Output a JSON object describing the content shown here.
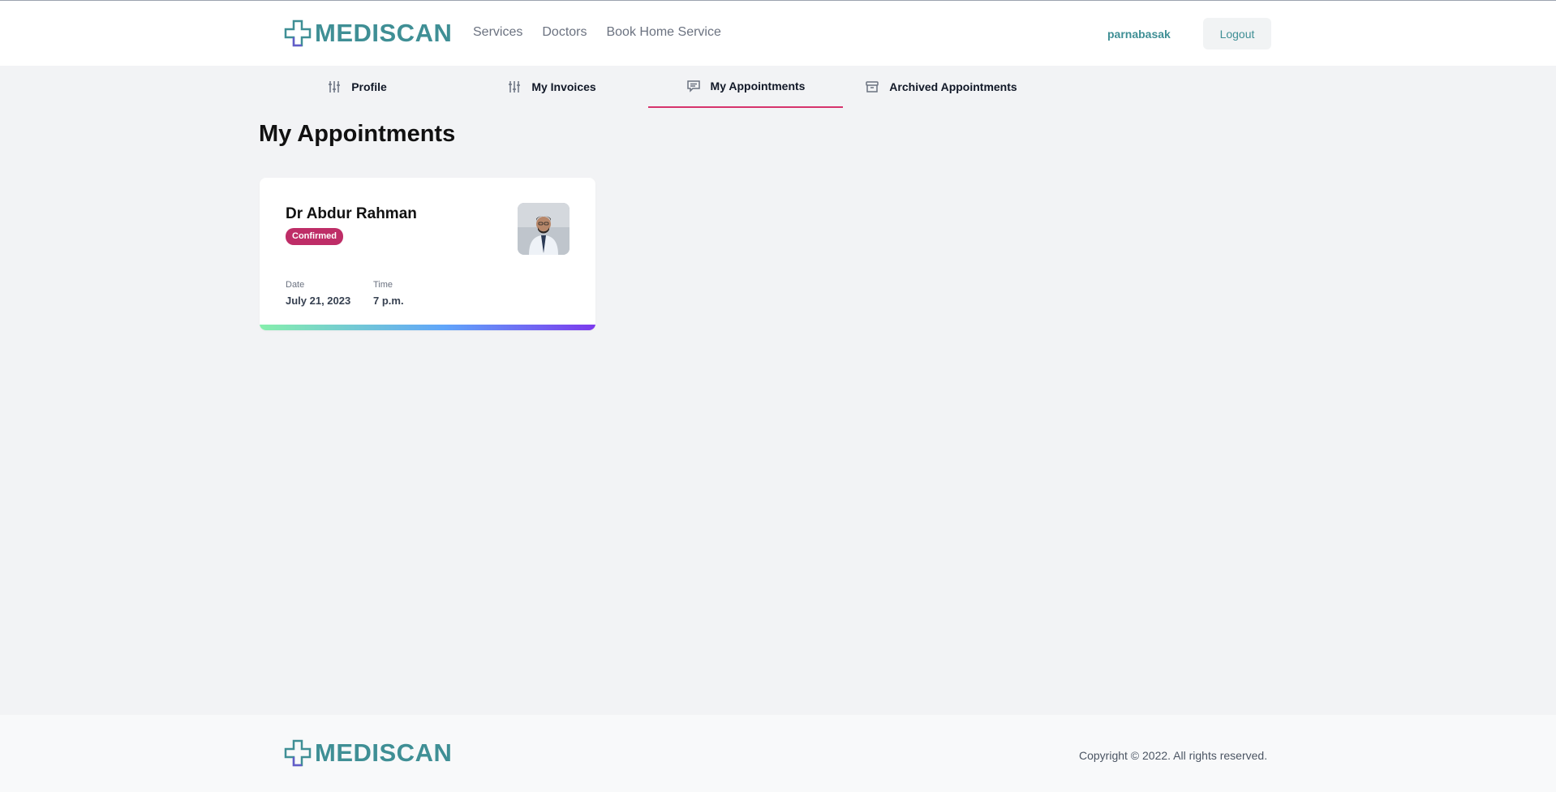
{
  "header": {
    "brand": "MEDISCAN",
    "nav": [
      "Services",
      "Doctors",
      "Book Home Service"
    ],
    "username": "parnabasak",
    "logout_label": "Logout"
  },
  "tabs": [
    {
      "label": "Profile",
      "icon": "sliders-icon"
    },
    {
      "label": "My Invoices",
      "icon": "sliders-icon"
    },
    {
      "label": "My Appointments",
      "icon": "chat-icon",
      "active": true
    },
    {
      "label": "Archived Appointments",
      "icon": "archive-icon"
    }
  ],
  "main": {
    "title": "My Appointments",
    "appointment": {
      "doctor": "Dr Abdur Rahman",
      "status": "Confirmed",
      "date_label": "Date",
      "date": "July 21, 2023",
      "time_label": "Time",
      "time": "7 p.m."
    }
  },
  "footer": {
    "brand": "MEDISCAN",
    "copyright": "Copyright © 2022. All rights reserved."
  },
  "colors": {
    "brand": "#3f8f95",
    "accent": "#d6336c",
    "status": "#be2d67"
  }
}
